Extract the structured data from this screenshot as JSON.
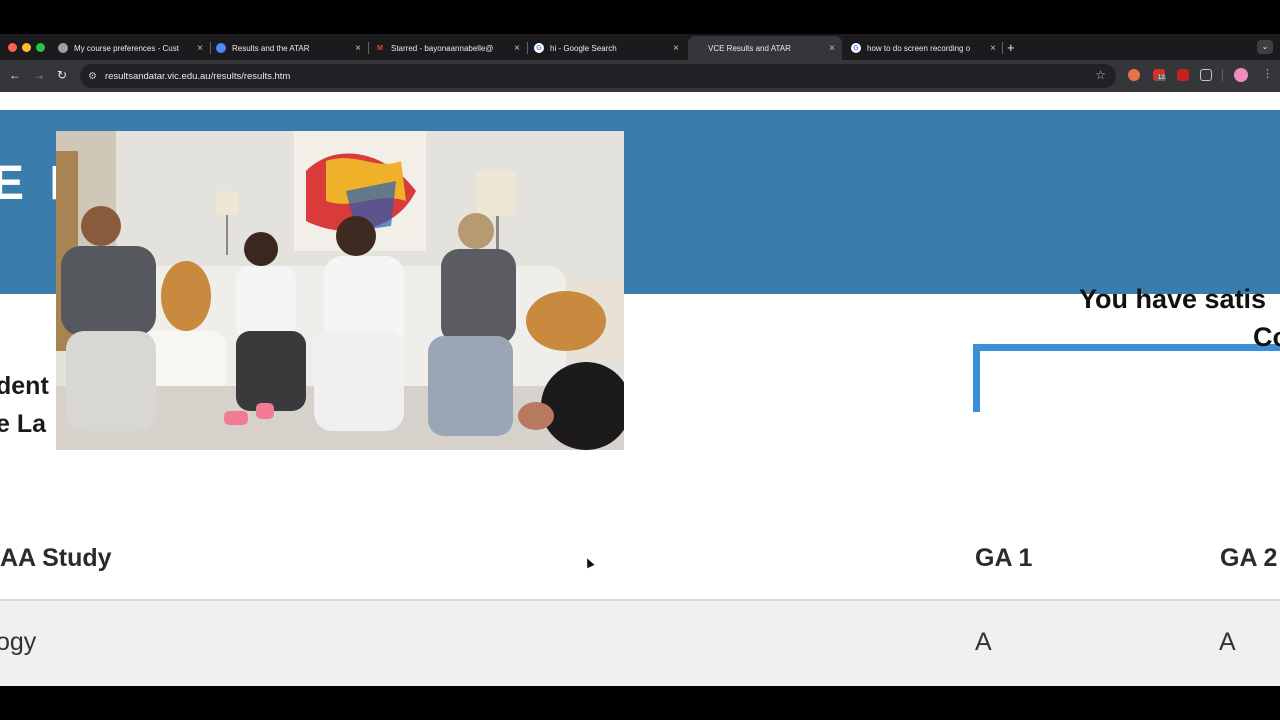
{
  "browser": {
    "tabs": [
      {
        "label": "My course preferences - Cust",
        "favicon": "globe-icon",
        "active": false
      },
      {
        "label": "Results and the ATAR",
        "favicon": "chrome-icon",
        "active": false
      },
      {
        "label": "Starred - bayonaannabelle@",
        "favicon": "gmail-icon",
        "active": false
      },
      {
        "label": "hi - Google Search",
        "favicon": "google-icon",
        "active": false
      },
      {
        "label": "VCE Results and ATAR",
        "favicon": "",
        "active": true
      },
      {
        "label": "how to do screen recording o",
        "favicon": "google-icon",
        "active": false
      }
    ],
    "close_glyph": "×",
    "newtab_glyph": "+",
    "url": "resultsandatar.vic.edu.au/results/results.htm",
    "extension_badge": "12"
  },
  "page": {
    "banner_title": "E F",
    "student_line1": "dent",
    "student_line2": "e La",
    "satisfied_line1": "You have satis",
    "satisfied_line2": "Co",
    "table": {
      "headers": {
        "study": "AA Study",
        "ga1": "GA 1",
        "ga2": "GA 2"
      },
      "row": {
        "study": "ogy",
        "ga1": "A",
        "ga2": "A"
      }
    }
  },
  "colors": {
    "banner": "#3a7cab",
    "box_accent": "#3a8fd6",
    "chrome_bg": "#202124"
  }
}
